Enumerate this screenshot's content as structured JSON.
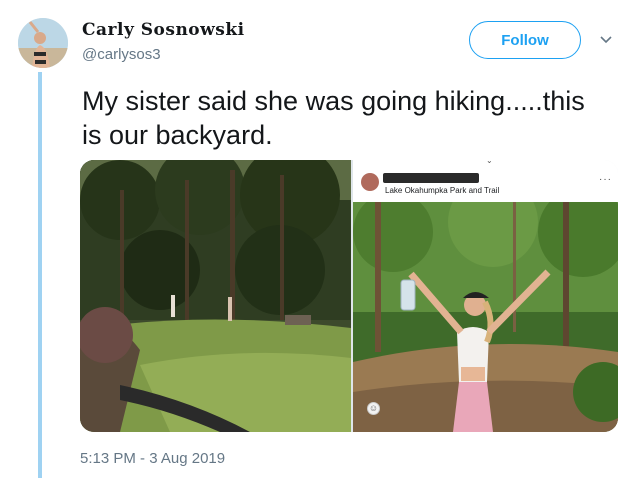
{
  "user": {
    "display_name": "Carly Sosnowski",
    "handle": "@carlysos3"
  },
  "actions": {
    "follow_label": "Follow"
  },
  "tweet": {
    "text": "My sister said she was going hiking.....this is our backyard.",
    "timestamp": "5:13 PM - 3 Aug 2019"
  },
  "embedded_post": {
    "location": "Lake Okahumpka Park and Trail",
    "more_icon": "ellipsis-icon"
  },
  "colors": {
    "accent": "#1da1f2",
    "thread_line": "#9fd2f2",
    "muted_text": "#657786"
  }
}
